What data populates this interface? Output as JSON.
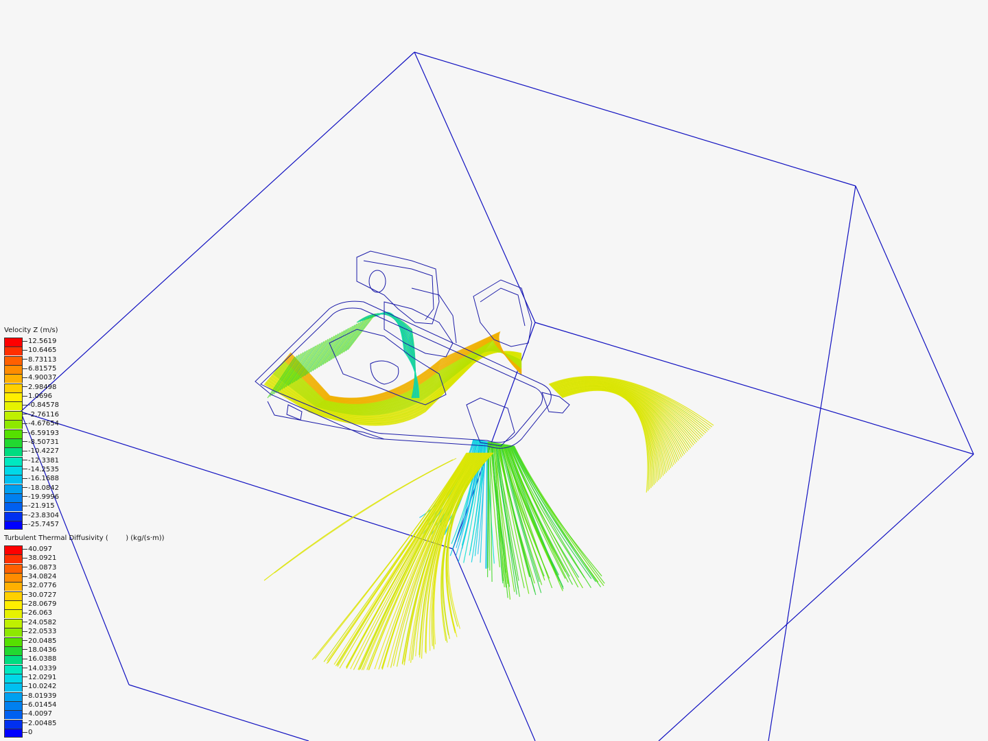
{
  "legends": [
    {
      "title": "Velocity Z (m/s)",
      "labels": [
        "12.5619",
        "10.6465",
        "8.73113",
        "6.81575",
        "4.90037",
        "2.98498",
        "1.0696",
        "-0.84578",
        "-2.76116",
        "-4.67654",
        "-6.59193",
        "-8.50731",
        "-10.4227",
        "-12.3381",
        "-14.2535",
        "-16.1688",
        "-18.0842",
        "-19.9996",
        "-21.915",
        "-23.8304",
        "-25.7457"
      ],
      "colors": [
        "#ff0000",
        "#ff3000",
        "#ff6000",
        "#ff8c00",
        "#ffb000",
        "#ffd000",
        "#ffee00",
        "#e6f200",
        "#bff000",
        "#8ee800",
        "#55e000",
        "#22d830",
        "#00dc80",
        "#00e8c0",
        "#00d8e8",
        "#00c0f0",
        "#00a0f0",
        "#0080f0",
        "#0060f0",
        "#0030f0",
        "#0000ff"
      ]
    },
    {
      "title": "Turbulent Thermal Diffusivity (        ) (kg/(s·m))",
      "labels": [
        "40.097",
        "38.0921",
        "36.0873",
        "34.0824",
        "32.0776",
        "30.0727",
        "28.0679",
        "26.063",
        "24.0582",
        "22.0533",
        "20.0485",
        "18.0436",
        "16.0388",
        "14.0339",
        "12.0291",
        "10.0242",
        "8.01939",
        "6.01454",
        "4.0097",
        "2.00485",
        "0"
      ],
      "colors": [
        "#ff0000",
        "#ff3000",
        "#ff6000",
        "#ff8c00",
        "#ffb000",
        "#ffd000",
        "#ffee00",
        "#e6f200",
        "#bff000",
        "#8ee800",
        "#55e000",
        "#22d830",
        "#00dc80",
        "#00e8c0",
        "#00d8e8",
        "#00c0f0",
        "#00a0f0",
        "#0080f0",
        "#0060f0",
        "#0030f0",
        "#0000ff"
      ]
    }
  ],
  "colors": {
    "background": "#f6f6f6",
    "domain_box": "#1010c0",
    "geometry": "#1a1aa8"
  }
}
